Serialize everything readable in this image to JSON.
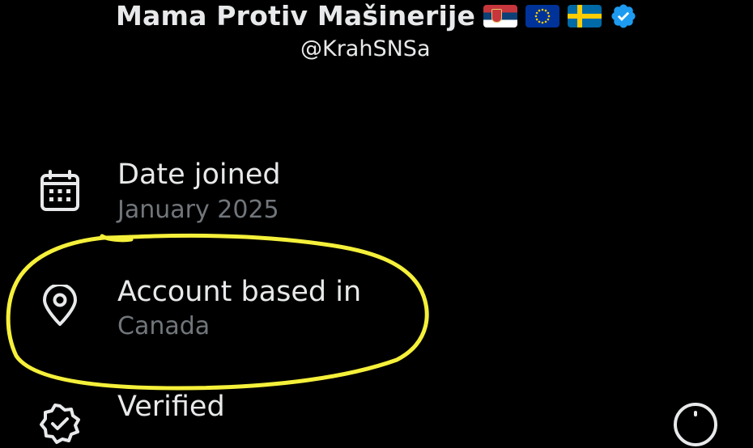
{
  "profile": {
    "display_name": "Mama Protiv Mašinerije",
    "flags": [
      "serbia-flag",
      "eu-flag",
      "sweden-flag"
    ],
    "verified": true,
    "handle": "@KrahSNSa"
  },
  "about": {
    "date_joined": {
      "icon": "calendar-icon",
      "title": "Date joined",
      "value": "January 2025"
    },
    "account_based_in": {
      "icon": "location-pin-icon",
      "title": "Account based in",
      "value": "Canada"
    },
    "verified": {
      "icon": "verified-badge-icon",
      "title": "Verified"
    }
  },
  "colors": {
    "background": "#000000",
    "primary_text": "#e7e9ea",
    "secondary_text": "#71767b",
    "verified_blue": "#1d9bf0",
    "highlight": "#f5f03a"
  }
}
